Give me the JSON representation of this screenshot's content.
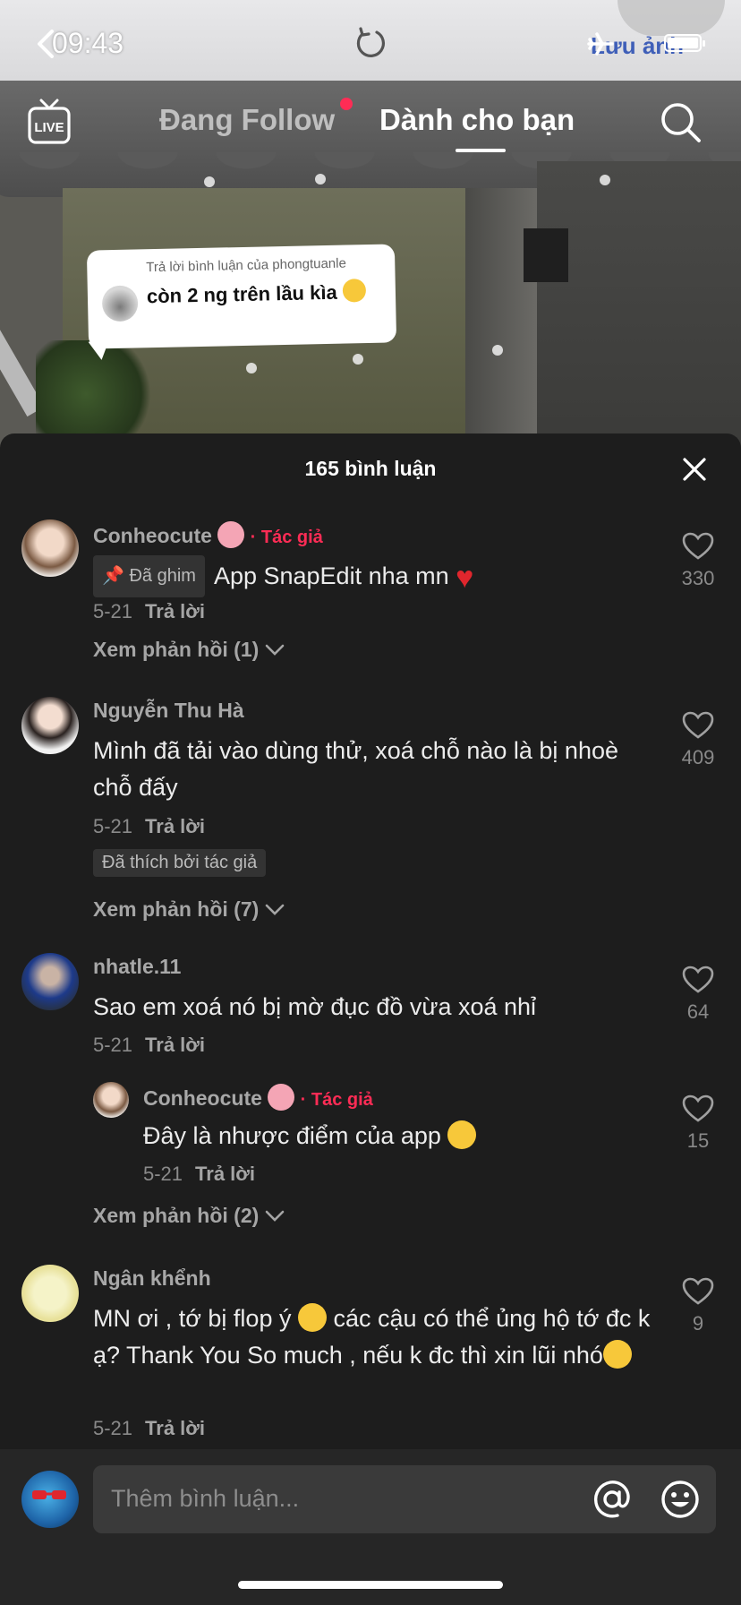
{
  "status_bar": {
    "time": "09:43",
    "save_label": "Lưu ảnh"
  },
  "nav": {
    "live_label": "LIVE",
    "tab_following": "Đang Follow",
    "tab_for_you": "Dành cho bạn"
  },
  "sticker": {
    "header": "Trả lời bình luận của phongtuanle",
    "text": "còn 2 ng trên lầu kìa"
  },
  "panel": {
    "title": "165 bình luận"
  },
  "comments": [
    {
      "user": "Conheocute",
      "author_tag": "· Tác giả",
      "pinned": "Đã ghim",
      "text": "App SnapEdit nha mn",
      "date": "5-21",
      "reply": "Trả lời",
      "likes": "330",
      "view_replies": "Xem phản hồi (1)"
    },
    {
      "user": "Nguyễn Thu Hà",
      "text": "Mình đã tải vào dùng thử, xoá chỗ nào là bị nhoè chỗ đấy",
      "date": "5-21",
      "reply": "Trả lời",
      "liked_by_author": "Đã thích bởi tác giả",
      "likes": "409",
      "view_replies": "Xem phản hồi (7)"
    },
    {
      "user": "nhatle.11",
      "text": "Sao em xoá nó bị mờ đục đồ vừa xoá nhỉ",
      "date": "5-21",
      "reply": "Trả lời",
      "likes": "64",
      "view_replies": "Xem phản hồi (2)",
      "sub": {
        "user": "Conheocute",
        "author_tag": "· Tác giả",
        "text": "Đây là nhược điểm của app",
        "date": "5-21",
        "reply": "Trả lời",
        "likes": "15"
      }
    },
    {
      "user": "Ngân khểnh",
      "text_1": "MN ơi , tớ bị flop ý",
      "text_2": "các cậu có thể ủng hộ tớ đc k ạ? Thank You So much , nếu k đc thì xin lũi nhó",
      "date": "5-21",
      "reply": "Trả lời",
      "likes": "9"
    }
  ],
  "input": {
    "placeholder": "Thêm bình luận..."
  },
  "colors": {
    "accent": "#fe2c55",
    "panel_bg": "#1d1d1d",
    "muted_text": "#8a8a8a"
  }
}
